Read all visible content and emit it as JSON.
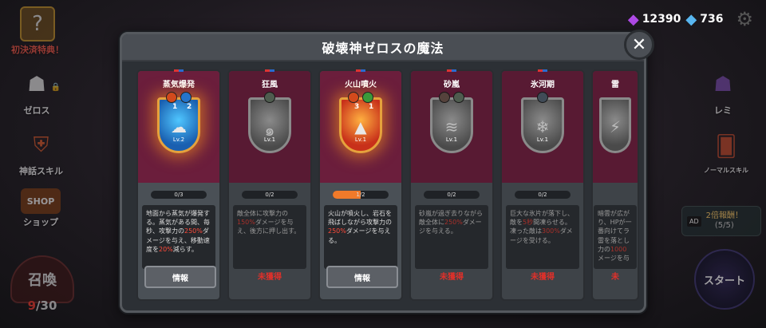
{
  "currency": {
    "amethyst": "12390",
    "crystal": "736"
  },
  "left_menu": {
    "first_bonus": "初決済特典！",
    "zeros": "ゼロス",
    "myth_skill": "神話スキル",
    "shop": "ショップ",
    "shop_badge": "SHOP",
    "summon": "召喚",
    "summon_count": "9",
    "summon_total": "/30"
  },
  "right_menu": {
    "remi": "レミ",
    "normal_skill": "ノーマルスキル",
    "ad_label": "AD",
    "ad_reward": "2倍報酬！",
    "ad_count": "(5/5)",
    "start": "スタート"
  },
  "modal": {
    "title": "破壊神ゼロスの魔法",
    "close": "✕",
    "info_label": "情報",
    "unacquired_label": "未獲得"
  },
  "cards": [
    {
      "name": "蒸気爆発",
      "progress": "0/3",
      "progress_fraction": 0.0,
      "level": "Lv.2",
      "orb_fire": "1",
      "orb_water": "2",
      "desc_a": "地面から蒸気が爆発する。蒸気がある間、毎秒、攻撃力の",
      "desc_b": "250%",
      "desc_c": "ダメージを与え、移動速度を",
      "desc_d": "20%",
      "desc_e": "減らす。"
    },
    {
      "name": "狂風",
      "progress": "0/2",
      "progress_fraction": 0.0,
      "level": "Lv.1",
      "desc_a": "敵全体に攻撃力の",
      "desc_b": "150%",
      "desc_c": "ダメージを与え、後方に押し出す。"
    },
    {
      "name": "火山噴火",
      "progress": "1/2",
      "progress_fraction": 0.5,
      "level": "Lv.1",
      "orb_fire": "3",
      "orb_wind": "1",
      "desc_a": "火山が噴火し、岩石を飛ばしながら攻撃力の",
      "desc_b": "250%",
      "desc_c": "ダメージを与える。"
    },
    {
      "name": "砂嵐",
      "progress": "0/2",
      "progress_fraction": 0.0,
      "level": "Lv.1",
      "desc_a": "砂嵐が過ぎ去りながら敵全体に",
      "desc_b": "250%",
      "desc_c": "ダメージを与える。"
    },
    {
      "name": "氷河期",
      "progress": "0/2",
      "progress_fraction": 0.0,
      "level": "Lv.1",
      "desc_a": "巨大な氷片が落下し、敵を",
      "desc_b": "5秒",
      "desc_c": "間凍らせる。凍った敵は",
      "desc_d": "300%",
      "desc_e": "ダメージを受ける。"
    },
    {
      "name": "雷",
      "desc_a": "暗雲が広がり、HPが一番向けてラ雷を落とし力の",
      "desc_b": "1000",
      "desc_c": "メージを与",
      "unacquired": "未"
    }
  ]
}
